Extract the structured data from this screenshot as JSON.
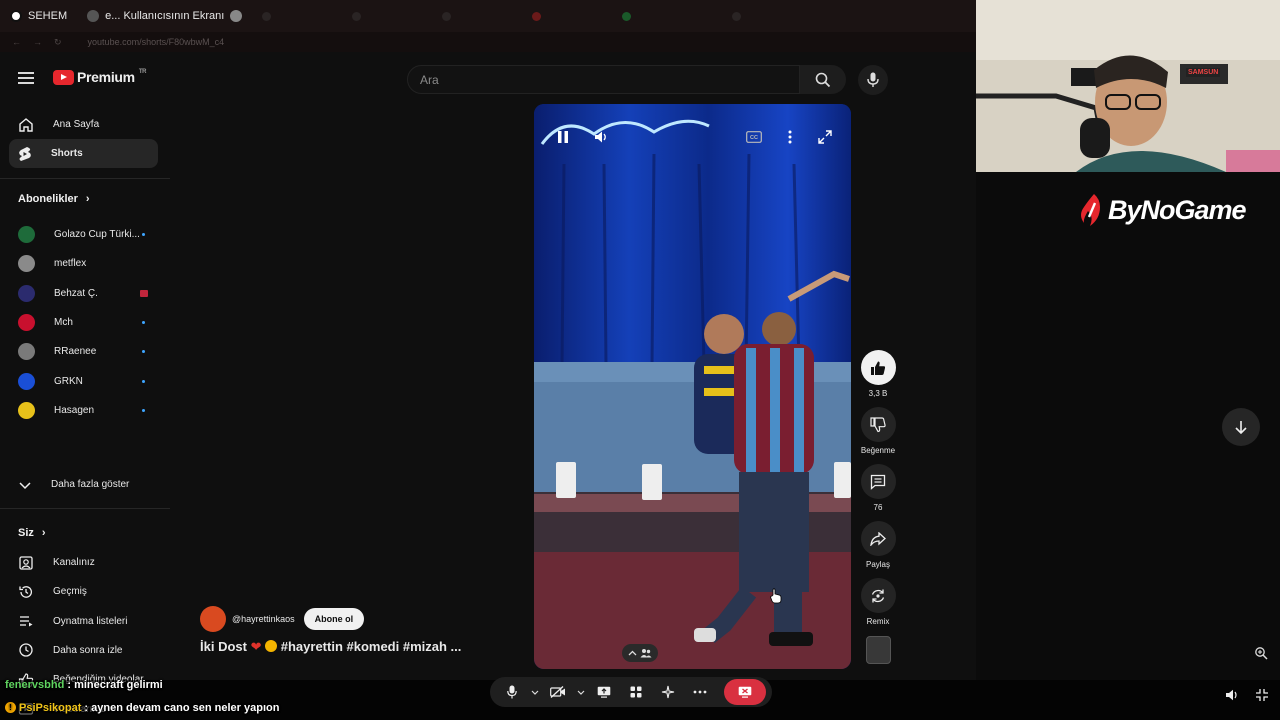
{
  "browser": {
    "tabs": [
      {
        "label": "SEHEM",
        "dim": false
      },
      {
        "label": "e... Kullanıcısının Ekranı",
        "dim": false
      },
      {
        "label": "",
        "dim": true
      },
      {
        "label": "",
        "dim": true
      },
      {
        "label": "",
        "dim": true
      },
      {
        "label": "",
        "dim": true
      },
      {
        "label": "",
        "dim": true
      },
      {
        "label": "",
        "dim": true
      }
    ],
    "url": "youtube.com/shorts/F80wbwM_c4"
  },
  "youtube": {
    "logo_text": "Premium",
    "logo_region": "TR",
    "search_placeholder": "Ara"
  },
  "sidebar": {
    "main": [
      {
        "label": "Ana Sayfa",
        "icon": "home-icon",
        "active": false
      },
      {
        "label": "Shorts",
        "icon": "shorts-icon",
        "active": true
      }
    ],
    "subscriptions_title": "Abonelikler",
    "subscriptions": [
      {
        "label": "Golazo Cup Türki...",
        "color": "#1e6b3a",
        "badge": "dot"
      },
      {
        "label": "metflex",
        "color": "#8a8a8a",
        "badge": ""
      },
      {
        "label": "Behzat Ç.",
        "color": "#2b2b6e",
        "badge": "live"
      },
      {
        "label": "Mch",
        "color": "#c8102e",
        "badge": "dot"
      },
      {
        "label": "RRaenee",
        "color": "#7a7a7a",
        "badge": "dot"
      },
      {
        "label": "GRKN",
        "color": "#1a4fd6",
        "badge": "dot"
      },
      {
        "label": "Hasagen",
        "color": "#e7c11a",
        "badge": "dot"
      }
    ],
    "show_more": "Daha fazla göster",
    "you_title": "Siz",
    "you": [
      {
        "label": "Kanalınız",
        "icon": "channel-icon"
      },
      {
        "label": "Geçmiş",
        "icon": "history-icon"
      },
      {
        "label": "Oynatma listeleri",
        "icon": "playlist-icon"
      },
      {
        "label": "Daha sonra izle",
        "icon": "clock-icon"
      },
      {
        "label": "Beğendiğim videolar",
        "icon": "like-icon"
      },
      {
        "label": "Videolarınız",
        "icon": "video-icon"
      }
    ]
  },
  "short": {
    "channel": "@hayrettinkaos",
    "subscribe": "Abone ol",
    "caption_start": "İki Dost",
    "caption_tags": "#hayrettin #komedi #mizah ...",
    "likes": "3,3 B",
    "dislike": "Beğenme",
    "comments": "76",
    "share": "Paylaş",
    "remix": "Remix"
  },
  "overlay": {
    "brand": "ByNoGame",
    "cam_sign": "SAMSUN",
    "chat": [
      {
        "user": "fenervsbhd",
        "sep": " : ",
        "message": "minecraft gelirmi"
      },
      {
        "user": "PsiPsikopat",
        "sep": " : ",
        "message": "aynen devam cano sen neler yapıon"
      }
    ]
  },
  "colors": {
    "accent_red": "#e6272d",
    "subscription_dot": "#3ea6ff",
    "end_call": "#d93040"
  }
}
